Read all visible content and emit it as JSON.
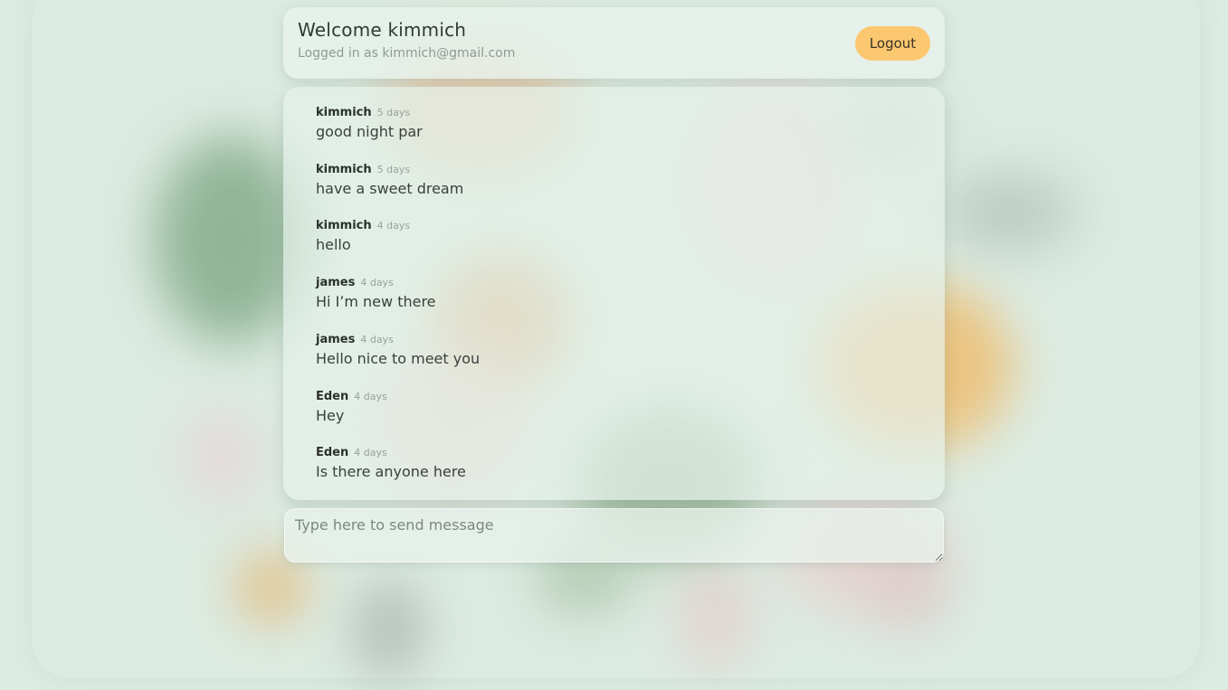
{
  "header": {
    "welcome_prefix": "Welcome ",
    "username": "kimmich",
    "subtitle": "Logged in as kimmich@gmail.com",
    "logout_label": "Logout"
  },
  "messages": [
    {
      "author": "kimmich",
      "time": "5 days",
      "text": "good night par"
    },
    {
      "author": "kimmich",
      "time": "5 days",
      "text": "have a sweet dream"
    },
    {
      "author": "kimmich",
      "time": "4 days",
      "text": "hello"
    },
    {
      "author": "james",
      "time": "4 days",
      "text": "Hi I’m new there"
    },
    {
      "author": "james",
      "time": "4 days",
      "text": "Hello nice to meet you"
    },
    {
      "author": "Eden",
      "time": "4 days",
      "text": "Hey"
    },
    {
      "author": "Eden",
      "time": "4 days",
      "text": "Is there anyone here"
    }
  ],
  "composer": {
    "placeholder": "Type here to send message",
    "value": ""
  },
  "colors": {
    "accent": "#fbc76f",
    "background": "#dcece2",
    "text": "#2f3a33",
    "muted": "#8f9a94"
  }
}
